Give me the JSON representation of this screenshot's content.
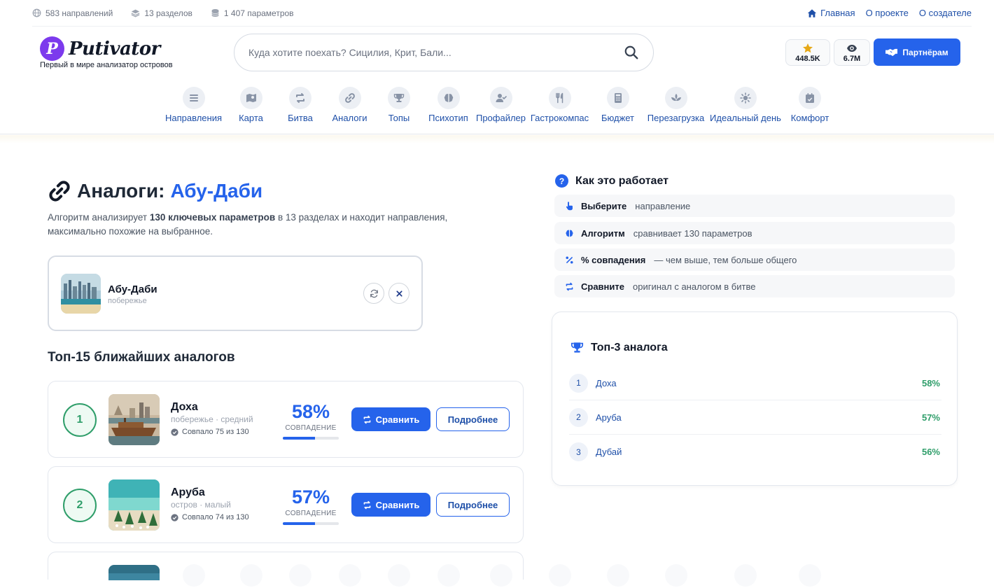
{
  "topbar": {
    "stats": [
      "583 направлений",
      "13 разделов",
      "1 407 параметров"
    ],
    "links": [
      "Главная",
      "О проекте",
      "О создателе"
    ]
  },
  "header": {
    "logo_letter": "P",
    "logo_text": "Putivator",
    "tagline": "Первый в мире анализатор островов",
    "search_placeholder": "Куда хотите поехать? Сицилия, Крит, Бали...",
    "rating": "448.5K",
    "views": "6.7M",
    "partner_label": "Партнёрам"
  },
  "nav": {
    "items": [
      {
        "label": "Направления",
        "icon": "list-icon"
      },
      {
        "label": "Карта",
        "icon": "map-icon"
      },
      {
        "label": "Битва",
        "icon": "swap-icon"
      },
      {
        "label": "Аналоги",
        "icon": "link-icon"
      },
      {
        "label": "Топы",
        "icon": "trophy-icon"
      },
      {
        "label": "Психотип",
        "icon": "brain-icon"
      },
      {
        "label": "Профайлер",
        "icon": "user-check-icon"
      },
      {
        "label": "Гастрокомпас",
        "icon": "utensils-icon"
      },
      {
        "label": "Бюджет",
        "icon": "calculator-icon"
      },
      {
        "label": "Перезагрузка",
        "icon": "spa-icon"
      },
      {
        "label": "Идеальный день",
        "icon": "sun-icon"
      },
      {
        "label": "Комфорт",
        "icon": "calendar-icon"
      }
    ]
  },
  "page": {
    "title_prefix": "Аналоги:",
    "title_city": "Абу-Даби",
    "intro_pre": "Алгоритм анализирует ",
    "intro_bold": "130 ключевых параметров",
    "intro_post": " в 13 разделах и находит направления, максимально похожие на выбранное.",
    "selected": {
      "name": "Абу-Даби",
      "type": "побережье"
    },
    "results_title": "Топ-15 ближайших аналогов"
  },
  "results": [
    {
      "rank": "1",
      "name": "Доха",
      "tags": "побережье · средний",
      "matched": "Совпало 75 из 130",
      "pct": "58%",
      "pct_value": 58,
      "pct_label": "СОВПАДЕНИЕ",
      "compare": "Сравнить",
      "more": "Подробнее"
    },
    {
      "rank": "2",
      "name": "Аруба",
      "tags": "остров · малый",
      "matched": "Совпало 74 из 130",
      "pct": "57%",
      "pct_value": 57,
      "pct_label": "СОВПАДЕНИЕ",
      "compare": "Сравнить",
      "more": "Подробнее"
    }
  ],
  "how": {
    "title": "Как это работает",
    "steps": [
      {
        "bold": "Выберите",
        "text": "направление",
        "icon": "pointer-icon"
      },
      {
        "bold": "Алгоритм",
        "text": "сравнивает 130 параметров",
        "icon": "brain-icon"
      },
      {
        "bold": "% совпадения",
        "text": "— чем выше, тем больше общего",
        "icon": "percent-icon"
      },
      {
        "bold": "Сравните",
        "text": "оригинал с аналогом в битве",
        "icon": "swap-icon"
      }
    ]
  },
  "top3": {
    "title": "Топ-3 аналога",
    "items": [
      {
        "rank": "1",
        "name": "Доха",
        "pct": "58%"
      },
      {
        "rank": "2",
        "name": "Аруба",
        "pct": "57%"
      },
      {
        "rank": "3",
        "name": "Дубай",
        "pct": "56%"
      }
    ]
  },
  "colors": {
    "accent": "#2563eb",
    "green": "#2f9e6a",
    "logo": "#7c3aed"
  }
}
